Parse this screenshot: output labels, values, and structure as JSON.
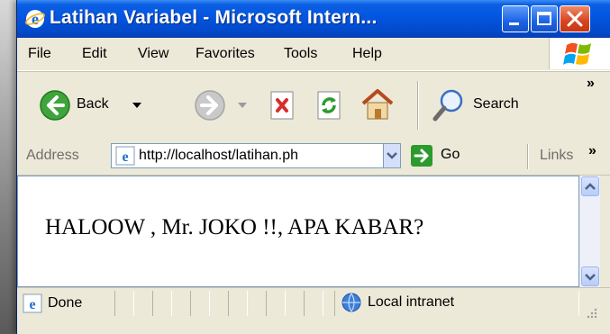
{
  "window": {
    "title": "Latihan Variabel - Microsoft Intern...",
    "title_color": "#0355e0",
    "close_color": "#d8431f"
  },
  "menu": {
    "file": "File",
    "edit": "Edit",
    "view": "View",
    "favorites": "Favorites",
    "tools": "Tools",
    "help": "Help"
  },
  "toolbar": {
    "back_label": "Back",
    "search_label": "Search",
    "overflow": "»",
    "icons": [
      "back-arrow-icon",
      "forward-arrow-icon",
      "stop-icon",
      "refresh-icon",
      "home-icon",
      "search-icon"
    ]
  },
  "address": {
    "label": "Address",
    "url": "http://localhost/latihan.ph",
    "go_label": "Go",
    "links_label": "Links",
    "overflow": "»"
  },
  "content": {
    "text": "HALOOW , Mr. JOKO !!, APA KABAR?"
  },
  "status": {
    "text": "Done",
    "zone": "Local intranet"
  }
}
